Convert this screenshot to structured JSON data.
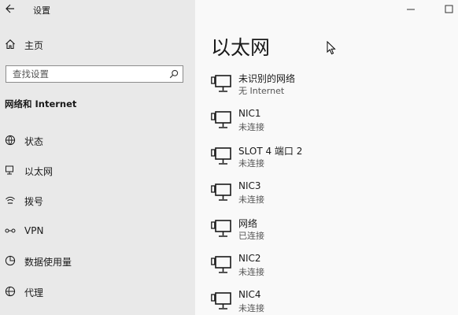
{
  "window": {
    "title": "设置"
  },
  "sidebar": {
    "home_label": "主页",
    "search_placeholder": "查找设置",
    "section_title": "网络和 Internet",
    "items": [
      {
        "label": "状态",
        "icon": "globe-icon"
      },
      {
        "label": "以太网",
        "icon": "ethernet-icon"
      },
      {
        "label": "拨号",
        "icon": "dialup-icon"
      },
      {
        "label": "VPN",
        "icon": "vpn-icon"
      },
      {
        "label": "数据使用量",
        "icon": "data-usage-icon"
      },
      {
        "label": "代理",
        "icon": "globe-icon"
      }
    ]
  },
  "main": {
    "title": "以太网",
    "networks": [
      {
        "name": "未识别的网络",
        "status": "无 Internet"
      },
      {
        "name": "NIC1",
        "status": "未连接"
      },
      {
        "name": "SLOT 4 端口 2",
        "status": "未连接"
      },
      {
        "name": "NIC3",
        "status": "未连接"
      },
      {
        "name": "网络",
        "status": "已连接"
      },
      {
        "name": "NIC2",
        "status": "未连接"
      },
      {
        "name": "NIC4",
        "status": "未连接"
      }
    ]
  }
}
